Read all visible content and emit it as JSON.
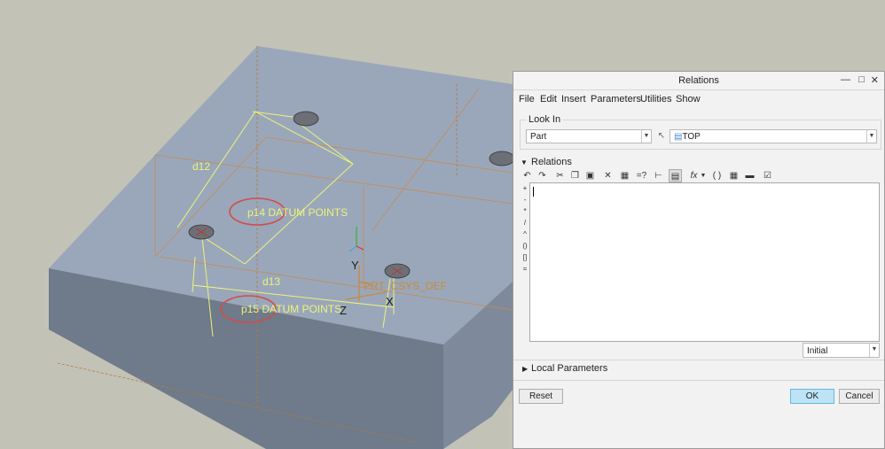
{
  "viewport": {
    "labels": {
      "d12": "d12",
      "d13": "d13",
      "p14": "p14 DATUM POINTS",
      "p15": "p15 DATUM POINTS",
      "y_axis": "Y",
      "z_axis": "Z",
      "x_axis": "X",
      "csys": "PRT_CSYS_DEF"
    },
    "colors": {
      "background": "#c3c2b6",
      "top_face": "#9aa7ba",
      "side_face": "#6f7a8a",
      "front_face": "#8592a4",
      "dimension": "#ecf37a",
      "highlight": "#d24c4c",
      "datum": "#c98a3c"
    }
  },
  "dialog": {
    "title": "Relations",
    "title_buttons": [
      "minimize-icon",
      "maximize-icon",
      "close-icon"
    ],
    "menu": [
      "File",
      "Edit",
      "Insert",
      "Parameters",
      "Utilities",
      "Show"
    ],
    "look_in": {
      "label": "Look In",
      "type_value": "Part",
      "object_value": "TOP"
    },
    "relations": {
      "label": "Relations",
      "toolbar_icons": [
        "undo-icon",
        "redo-icon",
        "cut-icon",
        "copy-icon",
        "paste-icon",
        "delete-icon",
        "switch-dims-icon",
        "evaluate-icon",
        "insert-parameter-icon",
        "units-icon",
        "function-icon",
        "parentheses-icon",
        "verify-icon",
        "sort-icon",
        "execute-icon"
      ],
      "side_operators": [
        "+",
        "-",
        "*",
        "/",
        "^",
        "()",
        "[]",
        "="
      ],
      "editor_text": "",
      "initial_select": "Initial"
    },
    "local_parameters": {
      "label": "Local Parameters"
    },
    "buttons": {
      "reset": "Reset",
      "ok": "OK",
      "cancel": "Cancel"
    }
  }
}
